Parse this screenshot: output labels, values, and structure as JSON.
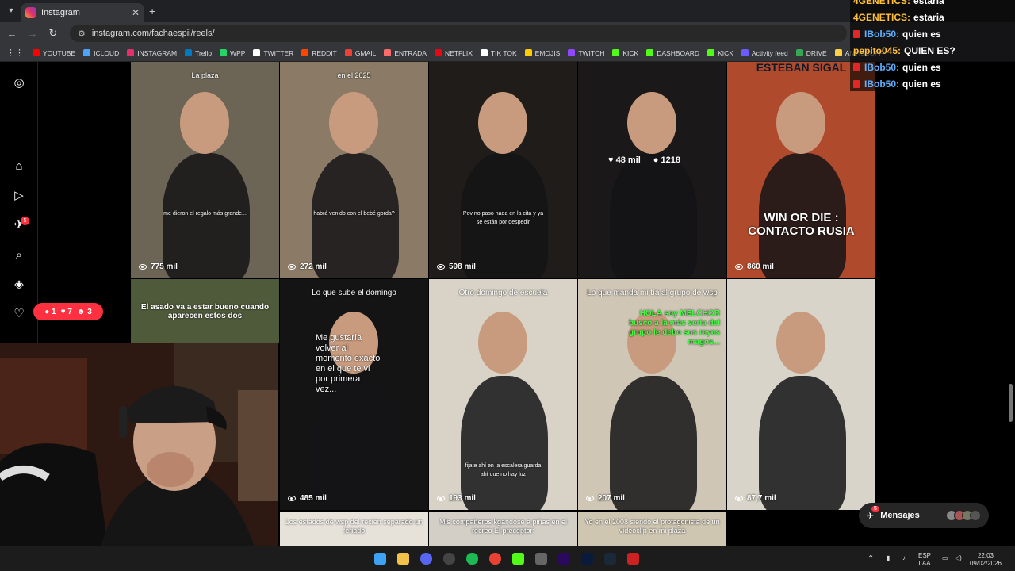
{
  "browser": {
    "tab_title": "Instagram",
    "url": "instagram.com/fachaespii/reels/",
    "bookmarks": [
      {
        "label": "YOUTUBE",
        "color": "#ff0000"
      },
      {
        "label": "ICLOUD",
        "color": "#4aa3ff"
      },
      {
        "label": "INSTAGRAM",
        "color": "#e1306c"
      },
      {
        "label": "Trello",
        "color": "#0079bf"
      },
      {
        "label": "WPP",
        "color": "#25d366"
      },
      {
        "label": "TWITTER",
        "color": "#ffffff"
      },
      {
        "label": "REDDIT",
        "color": "#ff4500"
      },
      {
        "label": "GMAIL",
        "color": "#ea4335"
      },
      {
        "label": "ENTRADA",
        "color": "#ff6b6b"
      },
      {
        "label": "NETFLIX",
        "color": "#e50914"
      },
      {
        "label": "TIK TOK",
        "color": "#ffffff"
      },
      {
        "label": "EMOJIS",
        "color": "#ffcc00"
      },
      {
        "label": "TWITCH",
        "color": "#9146ff"
      },
      {
        "label": "KICK",
        "color": "#53fc18"
      },
      {
        "label": "DASHBOARD",
        "color": "#53fc18"
      },
      {
        "label": "KICK",
        "color": "#53fc18"
      },
      {
        "label": "Activity feed",
        "color": "#6a5cff"
      },
      {
        "label": "DRIVE",
        "color": "#34a853"
      },
      {
        "label": "ANTISCUFF",
        "color": "#ffd04a"
      }
    ]
  },
  "sidebar": {
    "notif_badge": "5",
    "notif_pill": {
      "comments": "1",
      "likes": "7",
      "follows": "3"
    }
  },
  "reels": [
    {
      "caption_top": "La plaza",
      "caption_mid": "me dieron el regalo más grande...",
      "views": "775 mil",
      "bg": "#6c6455"
    },
    {
      "caption_top": "en el 2025",
      "caption_mid": "habrá venido con el bebé gorda?",
      "views": "272 mil",
      "bg": "#8a7a66"
    },
    {
      "caption_top": "",
      "caption_mid": "Pov no paso nada en la cita y ya se están por despedir",
      "views": "598 mil",
      "bg": "#1f1c1a"
    },
    {
      "caption_top": "",
      "caption_mid": "",
      "views": "",
      "likes": "48 mil",
      "comments": "1218",
      "bg": "#1a1818"
    },
    {
      "caption_top": "ESTEBAN SIGAL",
      "caption_mid": "WIN OR DIE : CONTACTO RUSIA",
      "views": "860 mil",
      "bg": "#b04a2c"
    },
    {
      "caption_top": "El asado va a estar bueno cuando aparecen estos dos",
      "caption_mid": "",
      "views": "",
      "bg": "#4f5a3a"
    },
    {
      "caption_top": "Lo que sube el domingo",
      "caption_mid": "Me gustaría volver al momento exacto en el que te vi por primera vez...",
      "views": "485 mil",
      "bg": "#141414"
    },
    {
      "caption_top": "Otro domingo de escuela",
      "caption_mid": "fijate ahí en la escalera guarda ahí que no hay luz",
      "views": "193 mil",
      "bg": "#d8d3c6"
    },
    {
      "caption_top": "Lo que manda mi tía al grupo de wsp",
      "caption_mid": "HOLA soy MELCHOR busco a la más seria del grupo le debo sus reyes magos...",
      "views": "207 mil",
      "bg": "#cfc6b6"
    },
    {
      "caption_top": "",
      "caption_mid": "",
      "views": "87,7 mil",
      "bg": "#d9d4c9"
    },
    {
      "caption_top": "Los estados de wsp del recién separado un feriado",
      "caption_mid": "",
      "views": "",
      "bg": "#e6e2da"
    },
    {
      "caption_top": "Mis compañeros kgandose a piñas en el recreo El preceptor:",
      "caption_mid": "",
      "views": "",
      "bg": "#d3cfc7"
    },
    {
      "caption_top": "Yo en el 2008 siendo el protagonista de un videoclip en mi plaza",
      "caption_mid": "",
      "views": "",
      "bg": "#cfc6b2"
    }
  ],
  "chat": [
    {
      "user": "4GENETICS:",
      "msg": "estaria",
      "badge": false
    },
    {
      "user": "4GENETICS:",
      "msg": "estaria",
      "badge": false
    },
    {
      "user": "IBob50:",
      "msg": "quien es",
      "badge": true
    },
    {
      "user": "pepito045:",
      "msg": "QUIEN ES?",
      "badge": false
    },
    {
      "user": "IBob50:",
      "msg": "quien es",
      "badge": true
    },
    {
      "user": "IBob50:",
      "msg": "quien es",
      "badge": true
    }
  ],
  "messages": {
    "label": "Mensajes",
    "badge": "5"
  },
  "taskbar": {
    "lang": "ESP",
    "region": "LAA",
    "time": "22:03",
    "date": "09/02/2026"
  }
}
